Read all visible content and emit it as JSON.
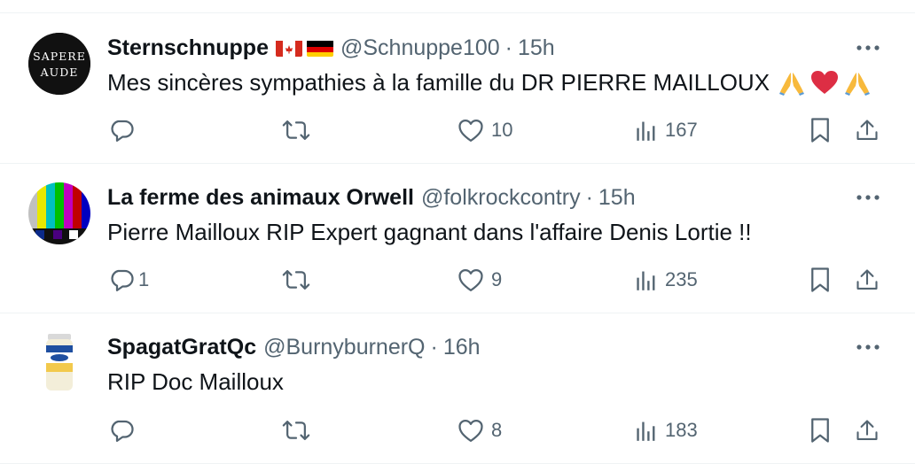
{
  "tweets": [
    {
      "display_name": "Sternschnuppe",
      "handle": "@Schnuppe100",
      "time": "15h",
      "text": "Mes sincères sympathies à la famille du DR PIERRE MAILLOUX",
      "avatar_text": [
        "SAPERE",
        "AUDE"
      ],
      "flags": [
        "canada-flag",
        "germany-flag"
      ],
      "emojis": [
        "folded-hands",
        "red-heart",
        "folded-hands"
      ],
      "stats": {
        "replies": "",
        "reposts": "",
        "likes": "10",
        "views": "167"
      }
    },
    {
      "display_name": "La ferme des animaux Orwell",
      "handle": "@folkrockcontry",
      "time": "15h",
      "text": "Pierre Mailloux RIP Expert gagnant dans l'affaire Denis Lortie !!",
      "avatar_text": [],
      "flags": [],
      "emojis": [],
      "stats": {
        "replies": "1",
        "reposts": "",
        "likes": "9",
        "views": "235"
      }
    },
    {
      "display_name": "SpagatGratQc",
      "handle": "@BurnyburnerQ",
      "time": "16h",
      "text": "RIP Doc Mailloux",
      "avatar_text": [],
      "flags": [],
      "emojis": [],
      "stats": {
        "replies": "",
        "reposts": "",
        "likes": "8",
        "views": "183"
      }
    }
  ],
  "ui": {
    "separator": "·"
  },
  "colors": {
    "text": "#0f1419",
    "secondary": "#536471",
    "border": "#eff3f4",
    "heart": "#e0245e"
  }
}
